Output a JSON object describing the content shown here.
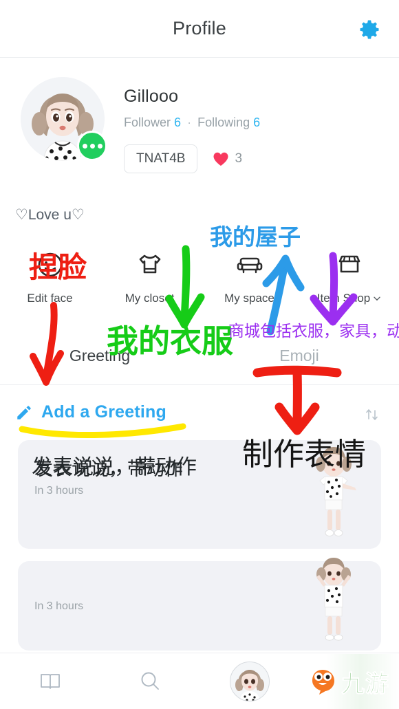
{
  "header": {
    "title": "Profile",
    "gear_icon": "gear-icon",
    "accent": "#1fa9e8"
  },
  "profile": {
    "username": "Gillooo",
    "follower_label": "Follower",
    "follower_count": "6",
    "separator": "·",
    "following_label": "Following",
    "following_count": "6",
    "code": "TNAT4B",
    "heart_icon": "heart-icon",
    "heart_count": "3",
    "status_text": "♡Love u♡",
    "badge_icon": "more-dots-icon",
    "badge_color": "#21ce5e",
    "link_color": "#2eb5f0"
  },
  "menu": [
    {
      "label": "Edit face",
      "icon": "face-icon"
    },
    {
      "label": "My closet",
      "icon": "tshirt-icon"
    },
    {
      "label": "My space",
      "icon": "sofa-icon"
    },
    {
      "label": "Item Shop",
      "icon": "shop-icon",
      "chevron": "chevron-down-icon"
    }
  ],
  "tabs": [
    {
      "label": "Greeting",
      "active": true
    },
    {
      "label": "Emoji",
      "active": false
    }
  ],
  "greeting": {
    "add_label": "Add a Greeting",
    "pencil_icon": "pencil-icon",
    "sort_icon": "sort-updown-icon",
    "accent": "#2ea8ef"
  },
  "cards": [
    {
      "text": "发表说说，带动作",
      "time": "In 3 hours",
      "character": "avatar-character"
    },
    {
      "text": "",
      "time": "In 3 hours",
      "character": "avatar-character"
    }
  ],
  "bottom_nav": [
    {
      "icon": "book-icon"
    },
    {
      "icon": "search-icon"
    },
    {
      "icon": "avatar-icon"
    },
    {
      "icon": "chat-bubble-icon"
    }
  ],
  "watermark": {
    "text": "九游",
    "mascot_icon": "mascot-icon",
    "mascot_color": "#f57722",
    "text_color": "#8ec98a"
  },
  "annotations": [
    {
      "id": "a1",
      "text": "捏脸",
      "color": "#ee1f13",
      "marker": "red-arrow-down",
      "target": "Edit face"
    },
    {
      "id": "a2",
      "text": "我的衣服",
      "color": "#16cc18",
      "marker": "green-arrow-down",
      "target": "My closet"
    },
    {
      "id": "a3",
      "text": "我的屋子",
      "color": "#2c9be8",
      "marker": "blue-arrow-up",
      "target": "My space"
    },
    {
      "id": "a4",
      "text": "商城包括衣服，家具，动作",
      "color": "#9b2ff0",
      "marker": "purple-arrow-down",
      "target": "Item Shop"
    },
    {
      "id": "a5",
      "text": "制作表情",
      "color": "#151515",
      "marker": "red-arrow-down-thick",
      "target": "Emoji"
    },
    {
      "id": "a6",
      "text": "",
      "color": "#ffe800",
      "marker": "yellow-underline",
      "target": "Add a Greeting"
    }
  ]
}
